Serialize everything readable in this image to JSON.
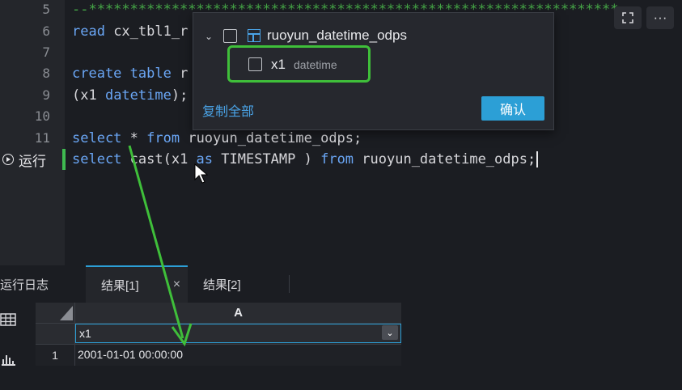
{
  "editor": {
    "line_numbers": [
      "5",
      "6",
      "7",
      "8",
      "9",
      "10",
      "11"
    ],
    "lines": [
      {
        "num": "5",
        "parts": [
          {
            "t": "--****************************************************************-",
            "c": "cm"
          }
        ]
      },
      {
        "num": "6",
        "parts": [
          {
            "t": "read",
            "c": "kw"
          },
          {
            "t": " cx_tbl1_r",
            "c": "tx"
          }
        ]
      },
      {
        "num": "7",
        "parts": []
      },
      {
        "num": "8",
        "parts": [
          {
            "t": "create table",
            "c": "kw"
          },
          {
            "t": " r",
            "c": "tx"
          }
        ]
      },
      {
        "num": "9",
        "parts": [
          {
            "t": "(x1 ",
            "c": "tx"
          },
          {
            "t": "datetime",
            "c": "kw"
          },
          {
            "t": ");",
            "c": "tx"
          }
        ]
      },
      {
        "num": "10",
        "parts": []
      },
      {
        "num": "11",
        "parts": [
          {
            "t": "select",
            "c": "kw"
          },
          {
            "t": " * ",
            "c": "tx"
          },
          {
            "t": "from",
            "c": "kw"
          },
          {
            "t": " ruoyun_datetime_odps;",
            "c": "tx"
          }
        ]
      },
      {
        "num": "",
        "parts": [
          {
            "t": "select",
            "c": "kw"
          },
          {
            "t": " cast(x1 ",
            "c": "tx"
          },
          {
            "t": "as",
            "c": "kw"
          },
          {
            "t": " TIMESTAMP ) ",
            "c": "tx"
          },
          {
            "t": "from",
            "c": "kw"
          },
          {
            "t": " ruoyun_datetime_odps;",
            "c": "tx"
          }
        ]
      }
    ],
    "run_label": "运行"
  },
  "popup": {
    "table_name": "ruoyun_datetime_odps",
    "field_name": "x1",
    "field_type": "datetime",
    "copy_all_label": "复制全部",
    "confirm_label": "确认"
  },
  "toolbar": {
    "expand_icon": "expand-icon",
    "more_label": "···"
  },
  "tabs": [
    {
      "label": "运行日志"
    },
    {
      "label": "结果[1]",
      "close": "×"
    },
    {
      "label": "结果[2]"
    }
  ],
  "result": {
    "column_letter": "A",
    "header_row": {
      "value": "x1",
      "dropdown": "⌄"
    },
    "rows": [
      {
        "index": "1",
        "value": "2001-01-01 00:00:00"
      }
    ]
  },
  "colors": {
    "accent": "#2c9fd6",
    "annotation_green": "#3fbf3a",
    "keyword": "#6aa6f5",
    "comment": "#46a847"
  }
}
